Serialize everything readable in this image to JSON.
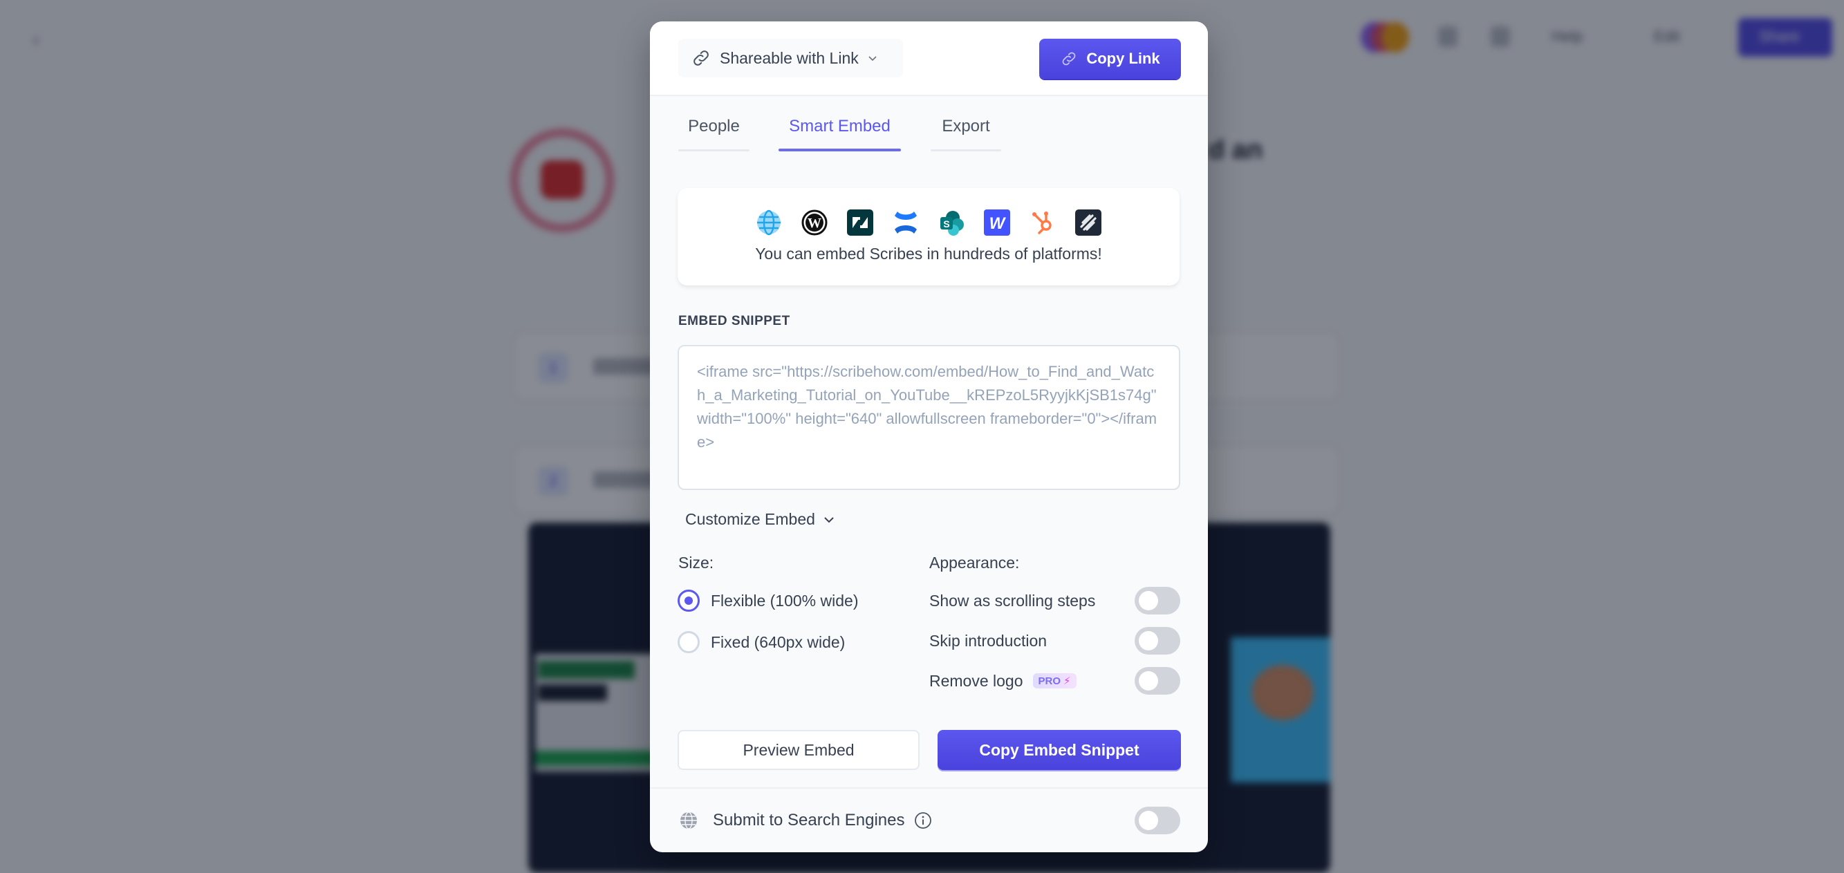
{
  "background": {
    "title_fragment": "d an",
    "share_button": "Share",
    "help_button": "Help",
    "edit_button": "Edit",
    "step_numbers": [
      "1",
      "2"
    ]
  },
  "modal": {
    "share_select": {
      "label": "Shareable with Link",
      "icon": "link-icon"
    },
    "copy_link_button": {
      "label": "Copy Link",
      "icon": "link-icon"
    },
    "tabs": [
      {
        "label": "People",
        "active": false
      },
      {
        "label": "Smart Embed",
        "active": true
      },
      {
        "label": "Export",
        "active": false
      }
    ],
    "platforms": {
      "icons": [
        "globe-icon",
        "wordpress-icon",
        "zendesk-icon",
        "confluence-icon",
        "sharepoint-icon",
        "webflow-icon",
        "hubspot-icon",
        "squarespace-icon"
      ],
      "text": "You can embed Scribes in hundreds of platforms!"
    },
    "embed_snippet": {
      "label": "EMBED SNIPPET",
      "value": "<iframe src=\"https://scribehow.com/embed/How_to_Find_and_Watch_a_Marketing_Tutorial_on_YouTube__kREPzoL5RyyjkKjSB1s74g\" width=\"100%\" height=\"640\" allowfullscreen frameborder=\"0\"></iframe>"
    },
    "customize_label": "Customize Embed",
    "size": {
      "label": "Size:",
      "options": [
        {
          "label": "Flexible (100% wide)",
          "checked": true
        },
        {
          "label": "Fixed (640px wide)",
          "checked": false
        }
      ]
    },
    "appearance": {
      "label": "Appearance:",
      "toggles": [
        {
          "label": "Show as scrolling steps",
          "on": false
        },
        {
          "label": "Skip introduction",
          "on": false
        },
        {
          "label": "Remove logo",
          "on": false,
          "badge": "PRO"
        }
      ]
    },
    "preview_button": "Preview Embed",
    "copy_embed_button": "Copy Embed Snippet",
    "search_engines": {
      "label": "Submit to Search Engines",
      "on": false
    }
  },
  "colors": {
    "accent": "#5b57ef",
    "toggle_off": "#d1d5db",
    "overlay": "rgba(17,24,39,0.5)"
  }
}
